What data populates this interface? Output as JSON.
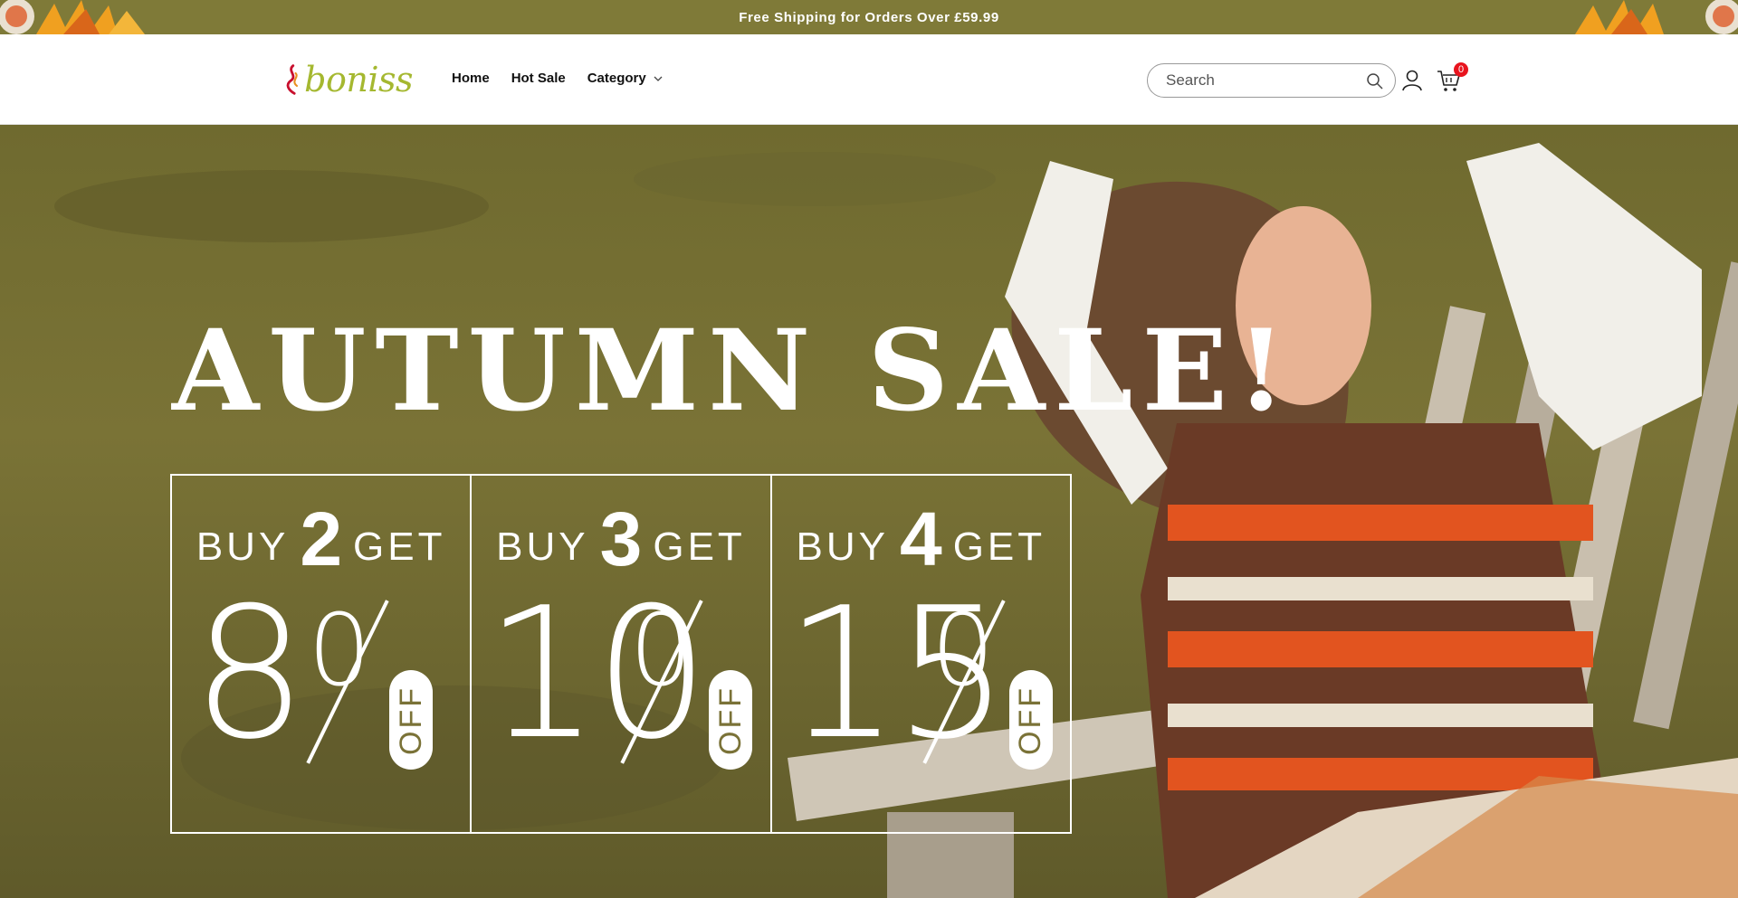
{
  "announcement": {
    "text": "Free Shipping for Orders Over £59.99",
    "background": "#7f7a38"
  },
  "header": {
    "logo_text": "boniss",
    "nav": [
      {
        "label": "Home"
      },
      {
        "label": "Hot Sale"
      },
      {
        "label": "Category",
        "has_dropdown": true
      }
    ],
    "search": {
      "placeholder": "Search",
      "icon": "search-icon"
    },
    "account_icon": "user-icon",
    "cart": {
      "icon": "cart-icon",
      "count": "0",
      "badge_color": "#e8141e"
    }
  },
  "hero": {
    "title": "AUTUMN SALE!",
    "offers": [
      {
        "buy": "BUY",
        "qty": "2",
        "get": "GET",
        "percent": "8",
        "off": "OFF"
      },
      {
        "buy": "BUY",
        "qty": "3",
        "get": "GET",
        "percent": "10",
        "off": "OFF"
      },
      {
        "buy": "BUY",
        "qty": "4",
        "get": "GET",
        "percent": "15",
        "off": "OFF"
      }
    ]
  }
}
